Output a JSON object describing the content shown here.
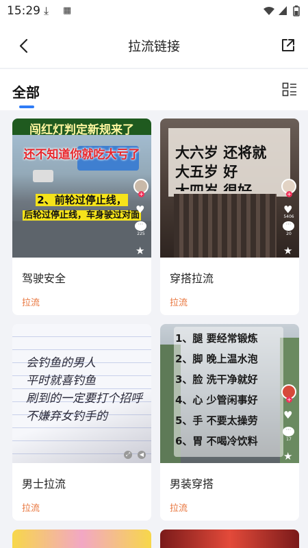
{
  "status_bar": {
    "time": "15:29"
  },
  "header": {
    "title": "拉流链接"
  },
  "tabs": {
    "active_label": "全部"
  },
  "cards": [
    {
      "title": "驾驶安全",
      "tag": "拉流",
      "thumb_texts": [
        "闯红灯判定新规来了",
        "还不知道你就吃大亏了",
        "2、前轮过停止线，",
        "后轮过停止线，车身驶过对面"
      ],
      "like_count": "",
      "comment_count": "225"
    },
    {
      "title": "穿搭拉流",
      "tag": "拉流",
      "thumb_texts": [
        "大六岁 还将就",
        "大五岁 好",
        "大四岁 很好"
      ],
      "like_count": "5406",
      "comment_count": "20"
    },
    {
      "title": "男士拉流",
      "tag": "拉流",
      "thumb_texts": [
        "会钓鱼的男人",
        "平时就喜钓鱼",
        "刷到的一定要打个招呼",
        "不嫌弃女钓手的"
      ]
    },
    {
      "title": "男装穿搭",
      "tag": "拉流",
      "thumb_texts": [
        "1、腿 要经常锻炼",
        "2、脚 晚上温水泡",
        "3、脸 洗干净就好",
        "4、心 少管闲事好",
        "5、手 不要太操劳",
        "6、胃 不喝冷饮料"
      ],
      "comment_count": "17"
    }
  ]
}
